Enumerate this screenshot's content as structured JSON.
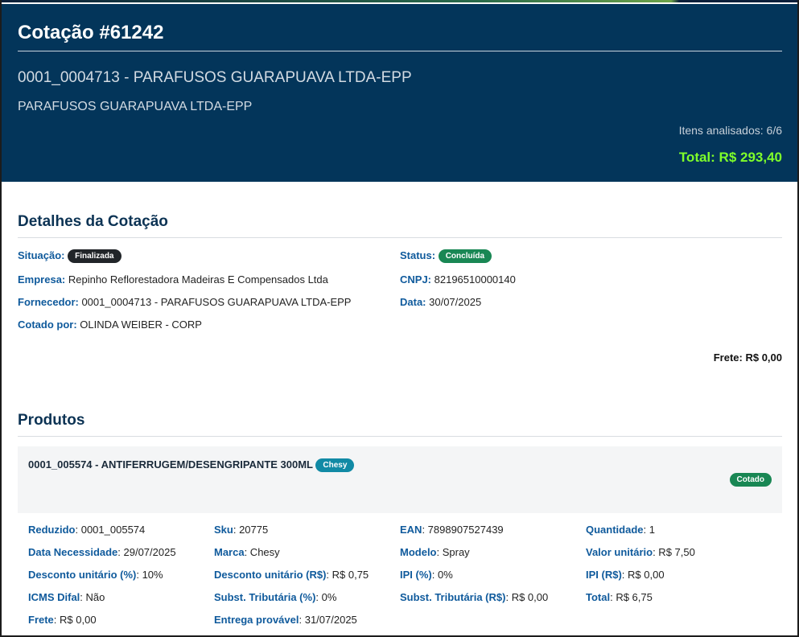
{
  "header": {
    "title": "Cotação #61242",
    "supplier": "0001_0004713 - PARAFUSOS GUARAPUAVA LTDA-EPP",
    "supplier_name": "PARAFUSOS GUARAPUAVA LTDA-EPP",
    "analyzed": "Itens analisados: 6/6",
    "total": "Total: R$ 293,40"
  },
  "details": {
    "heading": "Detalhes da Cotação",
    "situacao_label": "Situação:",
    "situacao_badge": "Finalizada",
    "status_label": "Status:",
    "status_badge": "Concluída",
    "empresa_label": "Empresa:",
    "empresa_value": " Repinho Reflorestadora Madeiras E Compensados Ltda",
    "cnpj_label": "CNPJ:",
    "cnpj_value": " 82196510000140",
    "fornecedor_label": "Fornecedor:",
    "fornecedor_value": " 0001_0004713 - PARAFUSOS GUARAPUAVA LTDA-EPP",
    "data_label": "Data:",
    "data_value": " 30/07/2025",
    "cotado_label": "Cotado por:",
    "cotado_value": " OLINDA WEIBER - CORP",
    "frete_total": "Frete: R$ 0,00"
  },
  "products": {
    "heading": "Produtos",
    "item": {
      "name": "0001_005574 - ANTIFERRUGEM/DESENGRIPANTE 300ML",
      "brand_badge": "Chesy",
      "status_badge": "Cotado",
      "fields": [
        {
          "label": "Reduzido",
          "value": ": 0001_005574"
        },
        {
          "label": "Sku",
          "value": ": 20775"
        },
        {
          "label": "EAN",
          "value": ": 7898907527439"
        },
        {
          "label": "Quantidade",
          "value": ": 1"
        },
        {
          "label": "Data Necessidade",
          "value": ": 29/07/2025"
        },
        {
          "label": "Marca",
          "value": ": Chesy"
        },
        {
          "label": "Modelo",
          "value": ": Spray"
        },
        {
          "label": "Valor unitário",
          "value": ": R$ 7,50"
        },
        {
          "label": "Desconto unitário (%)",
          "value": ": 10%"
        },
        {
          "label": "Desconto unitário (R$)",
          "value": ": R$ 0,75"
        },
        {
          "label": "IPI (%)",
          "value": ": 0%"
        },
        {
          "label": "IPI (R$)",
          "value": ": R$ 0,00"
        },
        {
          "label": "ICMS Difal",
          "value": ": Não"
        },
        {
          "label": "Subst. Tributária (%)",
          "value": ": 0%"
        },
        {
          "label": "Subst. Tributária (R$)",
          "value": ": R$ 0,00"
        },
        {
          "label": "Total",
          "value": ": R$ 6,75"
        },
        {
          "label": "Frete",
          "value": ": R$ 0,00"
        },
        {
          "label": "Entrega provável",
          "value": ": 31/07/2025"
        }
      ]
    }
  },
  "colors": {
    "header_bg": "#03355a",
    "label_blue": "#0f5a9c",
    "total_green": "#7fff2a",
    "badge_dark": "#212529",
    "badge_green": "#198754",
    "badge_teal": "#118aa5"
  }
}
